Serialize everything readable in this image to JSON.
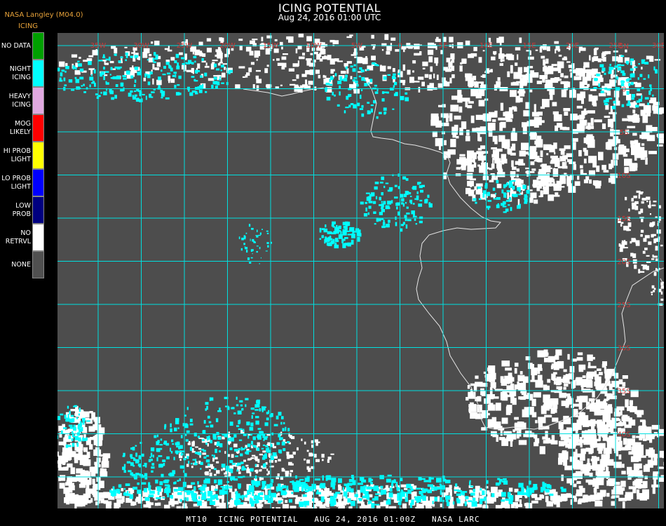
{
  "header": {
    "title": "ICING POTENTIAL",
    "subtitle": "Aug 24, 2016 01:00 UTC",
    "producer": "NASA Langley (M04.0)",
    "legend_title": "ICING"
  },
  "legend": [
    {
      "lines": [
        "NO DATA"
      ],
      "color": "#00a000"
    },
    {
      "lines": [
        "NIGHT",
        "ICING"
      ],
      "color": "#00ffff"
    },
    {
      "lines": [
        "HEAVY",
        "ICING"
      ],
      "color": "#e0a8e0"
    },
    {
      "lines": [
        "MOG",
        "LIKELY"
      ],
      "color": "#ff0000"
    },
    {
      "lines": [
        "HI PROB",
        "LIGHT"
      ],
      "color": "#ffff00"
    },
    {
      "lines": [
        "LO PROB",
        "LIGHT"
      ],
      "color": "#0000ff"
    },
    {
      "lines": [
        "LOW",
        "PROB"
      ],
      "color": "#000080"
    },
    {
      "lines": [
        "NO",
        "RETRVL"
      ],
      "color": "#ffffff"
    },
    {
      "lines": [
        "NONE"
      ],
      "color": "#505050"
    }
  ],
  "grid": {
    "color": "#00e0e0",
    "lon_labels": [
      "35W",
      "30W",
      "25W",
      "20W",
      "15W",
      "10W",
      "5W",
      "0",
      "5E",
      "10E",
      "15E",
      "20E",
      "25E",
      "30E",
      "35E"
    ],
    "lat_labels": [
      "5N",
      "0",
      "5S",
      "10S",
      "15S",
      "20S",
      "25S",
      "30S",
      "35S",
      "40S"
    ],
    "label_color": "#c83a3a"
  },
  "colors": {
    "background": "#4d4d4d",
    "night_icing": "#00ffff",
    "no_retrieval": "#ffffff",
    "coastline": "#e6e6e6"
  },
  "footer": {
    "text": "MT10  ICING POTENTIAL   AUG 24, 2016 01:00Z   NASA LARC"
  }
}
